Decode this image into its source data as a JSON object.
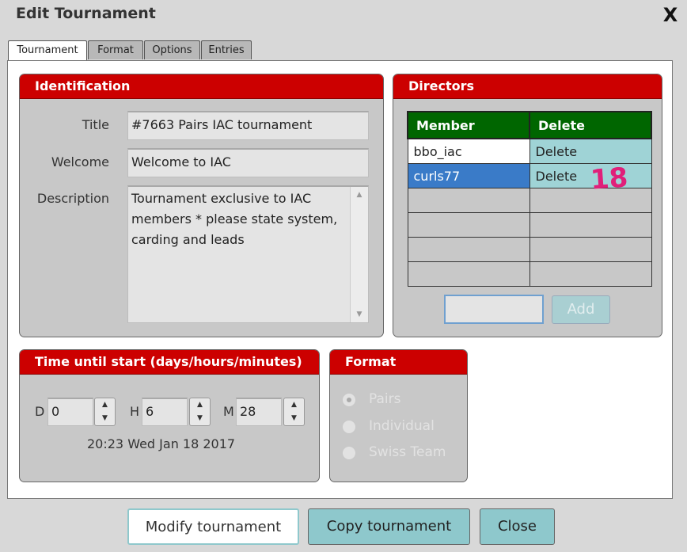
{
  "window": {
    "title": "Edit Tournament",
    "close_label": "X"
  },
  "tabs": [
    {
      "label": "Tournament",
      "active": true
    },
    {
      "label": "Format",
      "active": false
    },
    {
      "label": "Options",
      "active": false
    },
    {
      "label": "Entries",
      "active": false
    }
  ],
  "identification": {
    "header": "Identification",
    "title_label": "Title",
    "title_value": "#7663 Pairs IAC tournament",
    "welcome_label": "Welcome",
    "welcome_value": "Welcome to IAC",
    "description_label": "Description",
    "description_value": "Tournament exclusive to IAC members * please state system, carding and leads"
  },
  "directors": {
    "header": "Directors",
    "columns": [
      "Member",
      "Delete"
    ],
    "rows": [
      {
        "member": "bbo_iac",
        "action": "Delete"
      },
      {
        "member": "curls77",
        "action": "Delete"
      }
    ],
    "empty_rows": 4,
    "add_input_value": "",
    "add_label": "Add"
  },
  "time_until_start": {
    "header": "Time until start (days/hours/minutes)",
    "d_label": "D",
    "d_value": "0",
    "h_label": "H",
    "h_value": "6",
    "m_label": "M",
    "m_value": "28",
    "start_datetime": "20:23 Wed Jan 18 2017"
  },
  "format": {
    "header": "Format",
    "options": [
      {
        "label": "Pairs",
        "checked": true
      },
      {
        "label": "Individual",
        "checked": false
      },
      {
        "label": "Swiss Team",
        "checked": false
      }
    ]
  },
  "buttons": {
    "modify": "Modify tournament",
    "copy": "Copy tournament",
    "close": "Close"
  },
  "annotation": "18",
  "colors": {
    "header_red": "#cc0000",
    "table_header_green": "#006600",
    "selected_row_blue": "#3a7bc8",
    "delete_cell_teal": "#9fd3d6",
    "button_teal": "#8ec8cc",
    "annotation_pink": "#e0207a"
  },
  "icons": {
    "close": "close-icon",
    "stepper_up": "chevron-up-icon",
    "stepper_down": "chevron-down-icon",
    "scroll_up": "scroll-up-icon",
    "scroll_down": "scroll-down-icon"
  }
}
